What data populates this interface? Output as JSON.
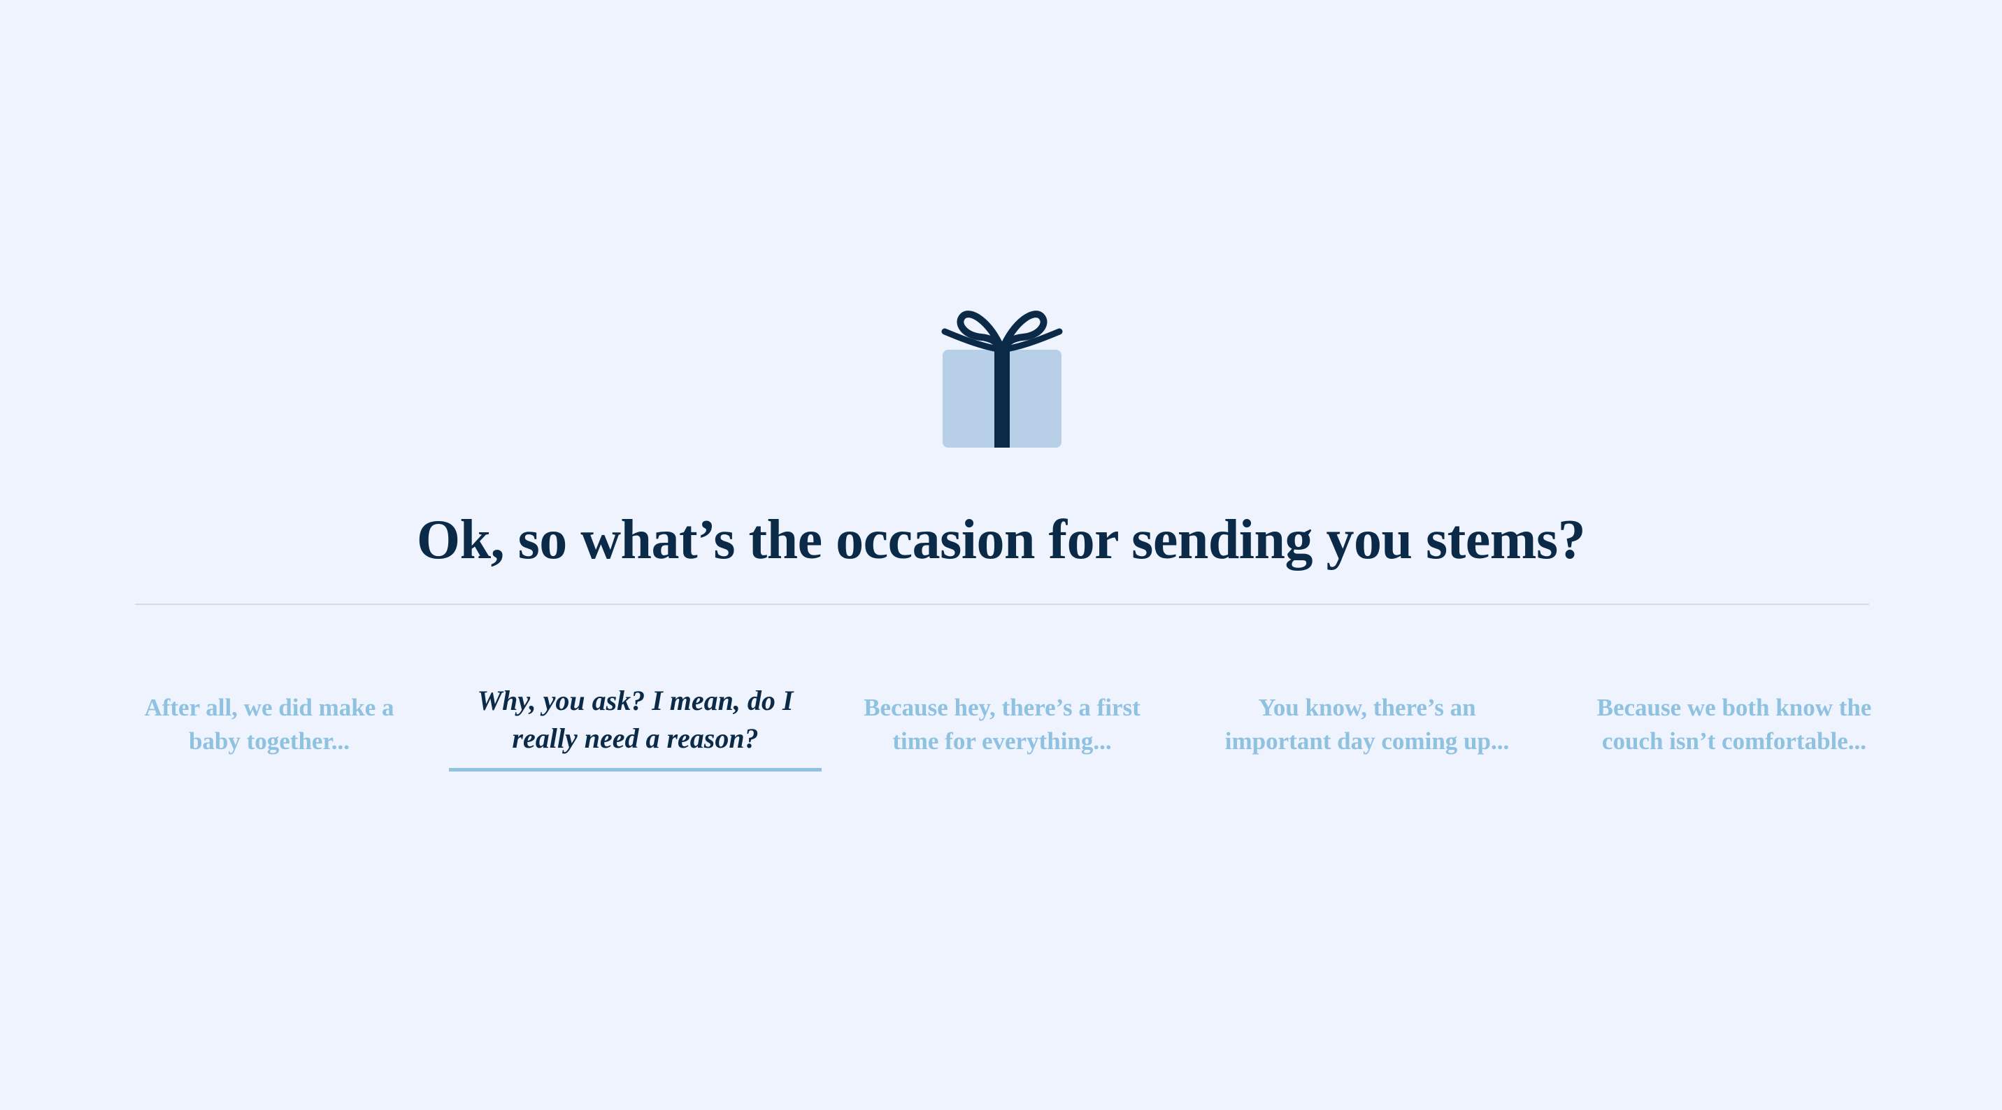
{
  "icon": "gift-icon",
  "colors": {
    "background": "#eef3fd",
    "heading": "#0b2a47",
    "option_inactive": "#8ec2e0",
    "option_selected": "#0b2a47",
    "underline": "#8ec2e0",
    "gift_box": "#b8cfe8",
    "gift_ribbon": "#0b2a47",
    "divider": "#d4dbe5"
  },
  "heading": "Ok, so what’s the occasion for sending you stems?",
  "options": [
    {
      "line1": "After all, we did make a",
      "line2": "baby together...",
      "selected": false
    },
    {
      "line1": "Why, you ask? I mean, do I",
      "line2": "really need a reason?",
      "selected": true
    },
    {
      "line1": "Because hey, there’s a first",
      "line2": "time for everything...",
      "selected": false
    },
    {
      "line1": "You know, there’s an",
      "line2": "important day coming up...",
      "selected": false
    },
    {
      "line1": "Because we both know the",
      "line2": "couch isn’t comfortable...",
      "selected": false
    }
  ]
}
